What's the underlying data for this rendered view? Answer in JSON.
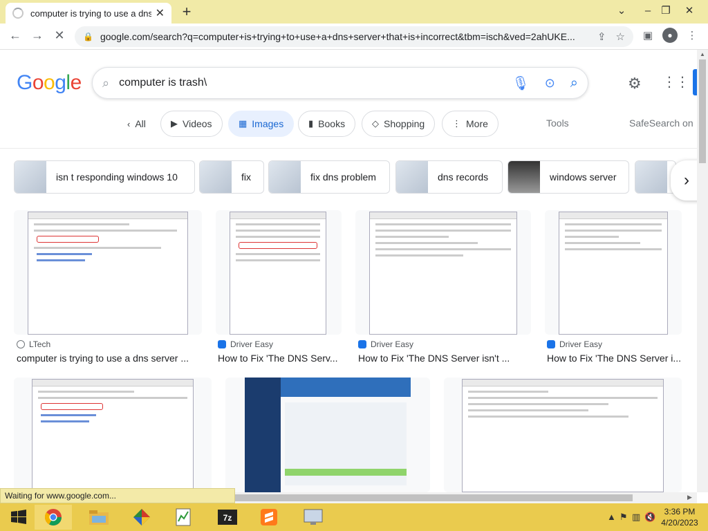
{
  "browser": {
    "tab_title": "computer is trying to use a dns s...",
    "url": "google.com/search?q=computer+is+trying+to+use+a+dns+server+that+is+incorrect&tbm=isch&ved=2ahUKE...",
    "status_text": "Waiting for www.google.com..."
  },
  "google": {
    "logo": "Google",
    "query": "computer is trash\\",
    "filters": [
      "All",
      "Videos",
      "Images",
      "Books",
      "Shopping",
      "More"
    ],
    "tools": "Tools",
    "safesearch": "SafeSearch on"
  },
  "related": [
    "isn t responding windows 10",
    "fix",
    "fix dns problem",
    "dns records",
    "windows server"
  ],
  "results": [
    {
      "source": "LTech",
      "caption": "computer is trying to use a dns server ..."
    },
    {
      "source": "Driver Easy",
      "caption": "How to Fix 'The DNS Serv..."
    },
    {
      "source": "Driver Easy",
      "caption": "How to Fix 'The DNS Server isn't ..."
    },
    {
      "source": "Driver Easy",
      "caption": "How to Fix 'The DNS Server i..."
    }
  ],
  "taskbar": {
    "time": "3:36 PM",
    "date": "4/20/2023",
    "apps": [
      "start",
      "chrome",
      "file-explorer",
      "color-app",
      "notepad-chart",
      "7zip",
      "sublime",
      "screen-app"
    ]
  },
  "colors": {
    "accent": "#1a73e8",
    "taskbar": "#eacb4e",
    "tabbar": "#f1eaa7"
  }
}
